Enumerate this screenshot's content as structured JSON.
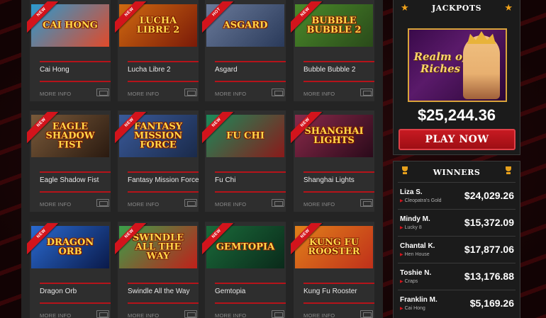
{
  "games": [
    {
      "title": "Cai Hong",
      "art_text": "CAI HONG",
      "badge": "NEW",
      "colors": [
        "#2a9ad0",
        "#e04a2a"
      ]
    },
    {
      "title": "Lucha Libre 2",
      "art_text": "LUCHA LIBRE 2",
      "badge": "NEW",
      "colors": [
        "#d06a10",
        "#7a1a08"
      ]
    },
    {
      "title": "Asgard",
      "art_text": "ASGARD",
      "badge": "HOT",
      "colors": [
        "#6a7a9a",
        "#2a3a5a"
      ]
    },
    {
      "title": "Bubble Bubble 2",
      "art_text": "BUBBLE BUBBLE 2",
      "badge": "NEW",
      "colors": [
        "#4a8a2a",
        "#2a4a1a"
      ]
    },
    {
      "title": "Eagle Shadow Fist",
      "art_text": "EAGLE SHADOW FIST",
      "badge": "NEW",
      "colors": [
        "#7a5a3a",
        "#2a1a10"
      ]
    },
    {
      "title": "Fantasy Mission Force",
      "art_text": "FANTASY MISSION FORCE",
      "badge": "NEW",
      "colors": [
        "#3a5a9a",
        "#1a2a4a"
      ]
    },
    {
      "title": "Fu Chi",
      "art_text": "FU CHI",
      "badge": "NEW",
      "colors": [
        "#1a8a5a",
        "#8a1a1a"
      ]
    },
    {
      "title": "Shanghai Lights",
      "art_text": "SHANGHAI LIGHTS",
      "badge": "NEW",
      "colors": [
        "#8a2a4a",
        "#2a0a1a"
      ]
    },
    {
      "title": "Dragon Orb",
      "art_text": "DRAGON ORB",
      "badge": "NEW",
      "colors": [
        "#2a6ad0",
        "#0a1a4a"
      ]
    },
    {
      "title": "Swindle All the Way",
      "art_text": "SWINDLE ALL THE WAY",
      "badge": "NEW",
      "colors": [
        "#3aa04a",
        "#c0201a"
      ]
    },
    {
      "title": "Gemtopia",
      "art_text": "GEMTOPIA",
      "badge": "NEW",
      "colors": [
        "#1a6a3a",
        "#0a2a1a"
      ]
    },
    {
      "title": "Kung Fu Rooster",
      "art_text": "KUNG FU ROOSTER",
      "badge": "NEW",
      "colors": [
        "#e0801a",
        "#c0301a"
      ]
    }
  ],
  "more_info_label": "MORE INFO",
  "jackpots": {
    "title": "JACKPOTS",
    "game_logo": "Realm of Riches",
    "amount": "$25,244.36",
    "play_label": "PLAY NOW"
  },
  "winners": {
    "title": "WINNERS",
    "rows": [
      {
        "name": "Liza S.",
        "game": "Cleopatra's Gold",
        "amount": "$24,029.26"
      },
      {
        "name": "Mindy M.",
        "game": "Lucky 8",
        "amount": "$15,372.09"
      },
      {
        "name": "Chantal K.",
        "game": "Hen House",
        "amount": "$17,877.06"
      },
      {
        "name": "Toshie N.",
        "game": "Craps",
        "amount": "$13,176.88"
      },
      {
        "name": "Franklin M.",
        "game": "Cai Hong",
        "amount": "$5,169.26"
      }
    ]
  },
  "colors": {
    "accent_red": "#b5131a",
    "star_orange": "#f0a21a",
    "panel_bg": "#1b1b1b"
  }
}
